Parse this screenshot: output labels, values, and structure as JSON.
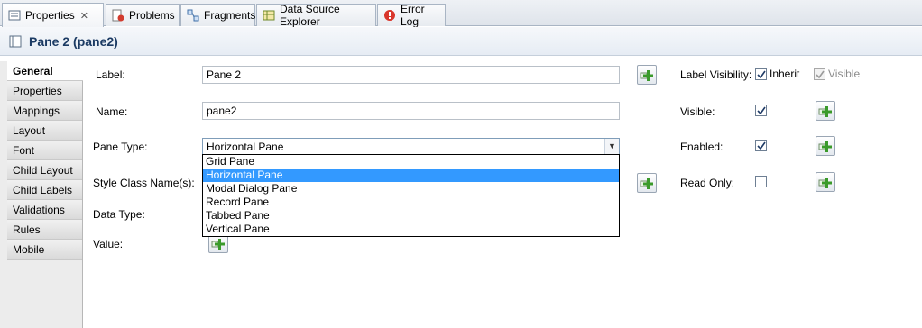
{
  "tabs": [
    {
      "label": "Properties",
      "icon": "properties-icon",
      "close": "✕"
    },
    {
      "label": "Problems",
      "icon": "problems-icon"
    },
    {
      "label": "Fragments",
      "icon": "fragments-icon"
    },
    {
      "label": "Data Source Explorer",
      "icon": "database-icon"
    },
    {
      "label": "Error Log",
      "icon": "error-log-icon"
    }
  ],
  "header": {
    "title": "Pane 2 (pane2)"
  },
  "sidebar": {
    "items": [
      {
        "label": "General"
      },
      {
        "label": "Properties"
      },
      {
        "label": "Mappings"
      },
      {
        "label": "Layout"
      },
      {
        "label": "Font"
      },
      {
        "label": "Child Layout"
      },
      {
        "label": "Child Labels"
      },
      {
        "label": "Validations"
      },
      {
        "label": "Rules"
      },
      {
        "label": "Mobile"
      }
    ]
  },
  "form": {
    "label_label": "Label:",
    "label_value": "Pane 2",
    "name_label": "Name:",
    "name_value": "pane2",
    "pane_type_label": "Pane Type:",
    "pane_type_value": "Horizontal Pane",
    "style_class_label": "Style Class Name(s):",
    "data_type_label": "Data Type:",
    "value_label": "Value:",
    "pane_type_options": [
      "Grid Pane",
      "Horizontal Pane",
      "Modal Dialog Pane",
      "Record Pane",
      "Tabbed Pane",
      "Vertical Pane"
    ]
  },
  "right": {
    "label_visibility": "Label Visibility:",
    "inherit": "Inherit",
    "visible_opt": "Visible",
    "visible": "Visible:",
    "enabled": "Enabled:",
    "read_only": "Read Only:"
  },
  "colors": {
    "selection": "#3399ff",
    "title": "#1b3a63",
    "plus_green": "#3a9a2a"
  }
}
